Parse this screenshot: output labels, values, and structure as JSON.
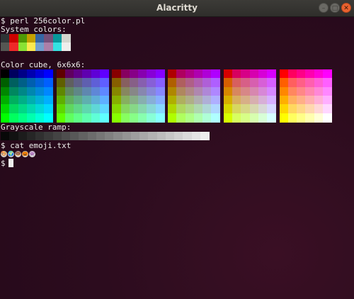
{
  "window": {
    "title": "Alacritty",
    "buttons": {
      "minimize": "–",
      "maximize": "□",
      "close": "✕"
    }
  },
  "terminal": {
    "cmd1": "$ perl 256color.pl",
    "system_label": "System colors:",
    "system_colors": [
      "#2e3436",
      "#cc0000",
      "#4e9a06",
      "#c4a000",
      "#3465a4",
      "#75507b",
      "#06989a",
      "#d3d7cf",
      "#555753",
      "#ef2929",
      "#8ae234",
      "#fce94f",
      "#729fcf",
      "#ad7fa8",
      "#34e2e2",
      "#eeeeec"
    ],
    "cube_label": "Color cube, 6x6x6:",
    "cube_levels": [
      0,
      95,
      135,
      175,
      215,
      255
    ],
    "grayscale_label": "Grayscale ramp:",
    "grayscale_levels": [
      8,
      18,
      28,
      38,
      48,
      58,
      68,
      78,
      88,
      98,
      108,
      118,
      128,
      138,
      148,
      158,
      168,
      178,
      188,
      198,
      208,
      218,
      228,
      238
    ],
    "cmd2": "$ cat emoji.txt",
    "emoji": [
      "🎨",
      "🌍",
      "🍩",
      "🎃",
      "👾"
    ],
    "prompt": "$"
  }
}
